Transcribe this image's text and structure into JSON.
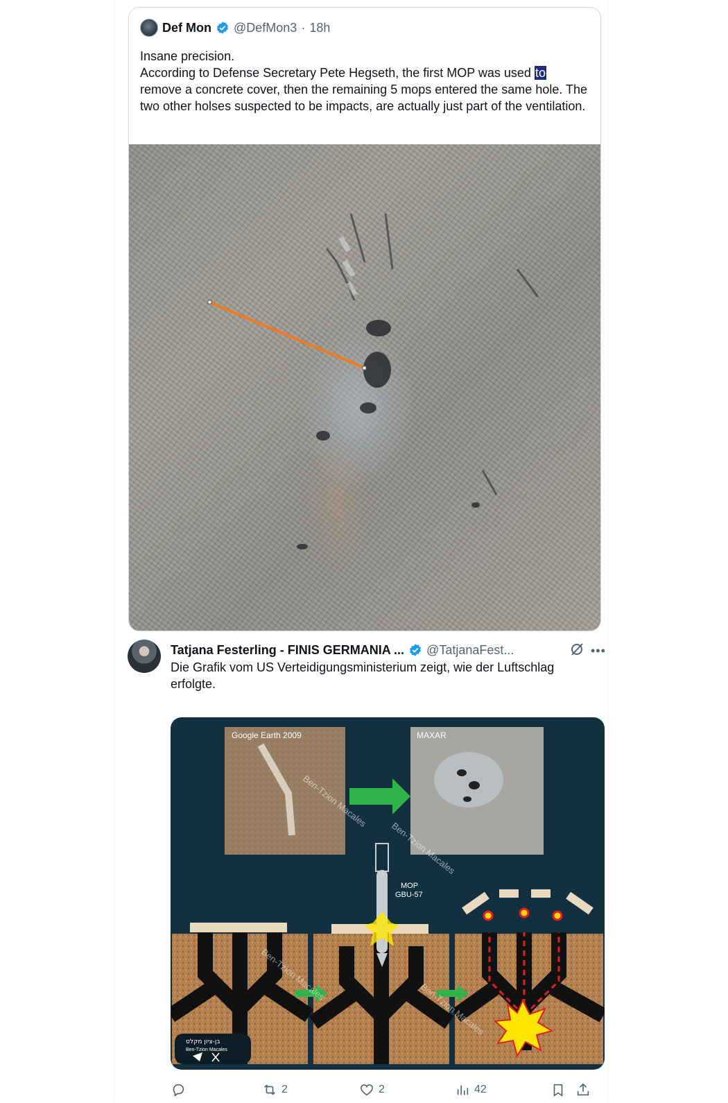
{
  "quoted_tweet": {
    "author_name": "Def Mon",
    "handle": "@DefMon3",
    "separator": "·",
    "time": "18h",
    "text_line1": "Insane precision.",
    "text_before_highlight": "According to Defense Secretary Pete Hegseth, the first MOP was used ",
    "text_highlight": "to",
    "text_after_highlight": " remove a concrete cover, then the remaining 5 mops entered the same hole. The two other holses suspected to be impacts, are actually just part of the ventilation.",
    "image_alt": "satellite image with orange measurement line"
  },
  "reply_tweet": {
    "author_name": "Tatjana Festerling - FINIS GERMANIA ...",
    "handle": "@TatjanaFest...",
    "text": "Die Grafik vom US Verteidigungsministerium zeigt, wie der Luftschlag erfolgte.",
    "graphic": {
      "left_photo_label": "Google Earth 2009",
      "right_photo_label": "MAXAR",
      "bomb_label_1": "MOP",
      "bomb_label_2": "GBU-57",
      "watermark": "Ben-Tzion Macales",
      "watermark_hebrew": "בן-ציון מקלס",
      "corner_badge_line1": "בן-ציון מקלס",
      "corner_badge_line2": "Ben-Tzion Macales"
    },
    "actions": {
      "reply_count": "",
      "retweet_count": "2",
      "like_count": "2",
      "views_count": "42"
    }
  },
  "colors": {
    "verified_blue": "#1d9bf0",
    "text_primary": "#0f1419",
    "text_secondary": "#536471",
    "measure_line": "#ee7a22",
    "graphic_bg": "#12303f"
  }
}
